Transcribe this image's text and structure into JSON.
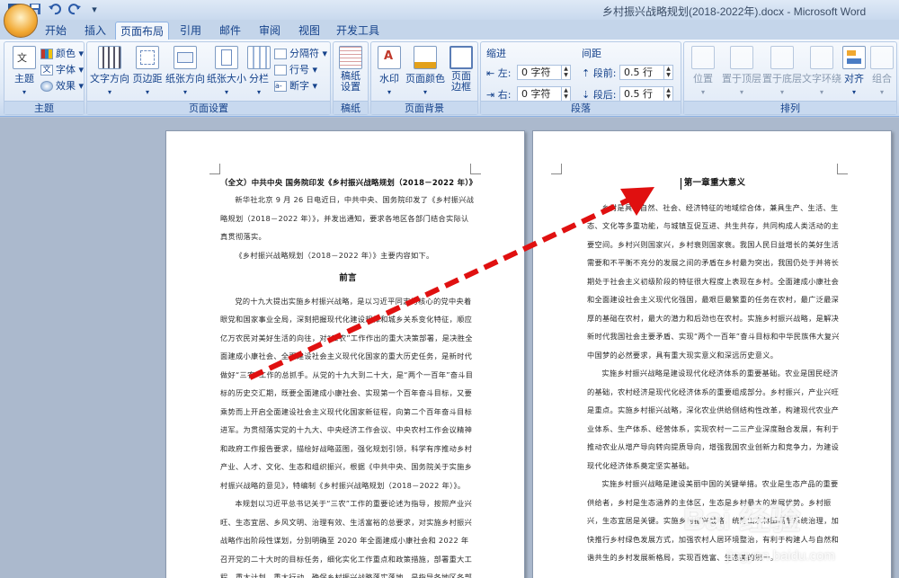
{
  "window": {
    "title": "乡村振兴战略规划(2018-2022年).docx - Microsoft Word"
  },
  "tabs": [
    "开始",
    "插入",
    "页面布局",
    "引用",
    "邮件",
    "审阅",
    "视图",
    "开发工具"
  ],
  "active_tab": "页面布局",
  "ribbon": {
    "theme": {
      "label": "主题",
      "btn": "主题",
      "colors": "颜色",
      "fonts": "字体",
      "effects": "效果"
    },
    "page_setup": {
      "label": "页面设置",
      "text_dir": "文字方向",
      "margins": "页边距",
      "orientation": "纸张方向",
      "size": "纸张大小",
      "columns": "分栏",
      "breaks": "分隔符",
      "line_numbers": "行号",
      "hyphenation": "断字"
    },
    "manuscript": {
      "label": "稿纸",
      "btn": "稿纸\n设置"
    },
    "page_bg": {
      "label": "页面背景",
      "watermark": "水印",
      "page_color": "页面颜色",
      "page_border": "页面\n边框"
    },
    "paragraph": {
      "label": "段落",
      "indent": "缩进",
      "spacing": "间距",
      "left": "左:",
      "right": "右:",
      "before": "段前:",
      "after": "段后:",
      "left_val": "0 字符",
      "right_val": "0 字符",
      "before_val": "0.5 行",
      "after_val": "0.5 行"
    },
    "arrange": {
      "label": "排列",
      "position": "位置",
      "bring_front": "置于顶层",
      "send_back": "置于底层",
      "wrap": "文字环绕",
      "align": "对齐",
      "group": "组合"
    }
  },
  "page1": {
    "title": "（全文）中共中央 国务院印发《乡村振兴战略规划（2018－2022 年）》",
    "paras": [
      "新华社北京 9 月 26 日电近日，中共中央、国务院印发了《乡村振兴战略规划（2018－2022 年）》，并发出通知，要求各地区各部门结合实际认真贯彻落实。",
      "《乡村振兴战略规划（2018－2022 年）》主要内容如下。"
    ],
    "heading": "前言",
    "body": [
      "党的十九大提出实施乡村振兴战略，是以习近平同志为核心的党中央着眼党和国家事业全局，深刻把握现代化建设规律和城乡关系变化特征，顺应亿万农民对美好生活的向往，对“三农”工作作出的重大决策部署，是决胜全面建成小康社会、全面建设社会主义现代化国家的重大历史任务，是新时代做好“三农”工作的总抓手。从党的十九大到二十大，是“两个一百年”奋斗目标的历史交汇期，既要全面建成小康社会、实现第一个百年奋斗目标，又要乘势而上开启全面建设社会主义现代化国家新征程，向第二个百年奋斗目标进军。为贯彻落实党的十九大、中央经济工作会议、中央农村工作会议精神和政府工作报告要求，描绘好战略蓝图，强化规划引领，科学有序推动乡村产业、人才、文化、生态和组织振兴，根据《中共中央、国务院关于实施乡村振兴战略的意见》，特编制《乡村振兴战略规划（2018－2022 年）》。",
      "本规划以习近平总书记关于“三农”工作的重要论述为指导，按照产业兴旺、生态宜居、乡风文明、治理有效、生活富裕的总要求，对实施乡村振兴战略作出阶段性谋划，分别明确至 2020 年全面建成小康社会和 2022 年召开党的二十大时的目标任务，细化实化工作重点和政策措施，部署重大工程、重大计划、重大行动，确保乡村振兴战略落实落地，是指导各地区各部门分类有序推进乡村振兴的重要依据。"
    ]
  },
  "page2": {
    "heading": "第一章重大意义",
    "body": [
      "乡村是具有自然、社会、经济特征的地域综合体，兼具生产、生活、生态、文化等多重功能，与城镇互促互进、共生共存，共同构成人类活动的主要空间。乡村兴则国家兴，乡村衰则国家衰。我国人民日益增长的美好生活需要和不平衡不充分的发展之间的矛盾在乡村最为突出，我国仍处于并将长期处于社会主义初级阶段的特征很大程度上表现在乡村。全面建成小康社会和全面建设社会主义现代化强国，最艰巨最繁重的任务在农村，最广泛最深厚的基础在农村，最大的潜力和后劲也在农村。实施乡村振兴战略，是解决新时代我国社会主要矛盾、实现“两个一百年”奋斗目标和中华民族伟大复兴中国梦的必然要求，具有重大现实意义和深远历史意义。",
      "实施乡村振兴战略是建设现代化经济体系的重要基础。农业是国民经济的基础，农村经济是现代化经济体系的重要组成部分。乡村振兴，产业兴旺是重点。实施乡村振兴战略，深化农业供给侧结构性改革，构建现代农业产业体系、生产体系、经营体系，实现农村一二三产业深度融合发展，有利于推动农业从增产导向转向提质导向，增强我国农业创新力和竞争力，为建设现代化经济体系奠定坚实基础。",
      "实施乡村振兴战略是建设美丽中国的关键举措。农业是生态产品的重要供给者，乡村是生态涵养的主体区，生态是乡村最大的发展优势。乡村振兴，生态宜居是关键。实施乡村振兴战略，统筹山水林田湖草系统治理，加快推行乡村绿色发展方式，加强农村人居环境整治，有利于构建人与自然和谐共生的乡村发展新格局，实现百姓富、生态美的统一。"
    ]
  },
  "watermark": {
    "text": "Bai 经验",
    "sub": "jingyan.baidu.com"
  },
  "colors": {
    "arrow": "#e01010",
    "accent": "#15428b"
  }
}
